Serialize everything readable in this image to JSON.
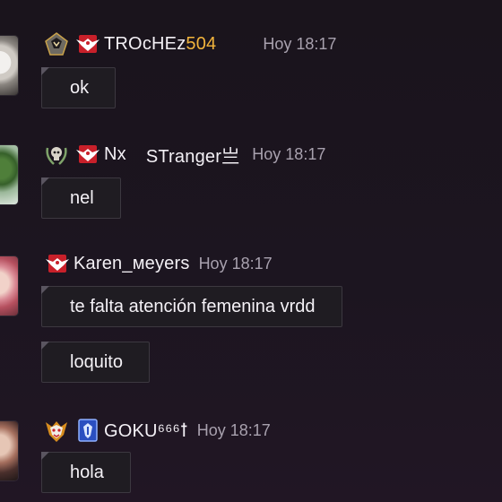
{
  "messages": [
    {
      "username": "TROcHEz",
      "username_suffix": "504",
      "time": "Hoy 18:17",
      "bubbles": [
        "ok"
      ]
    },
    {
      "username": "Nx",
      "username_suffix": "STranger亗",
      "time": "Hoy 18:17",
      "bubbles": [
        "nel"
      ]
    },
    {
      "username": "Karen_ᴍeyers",
      "time": "Hoy 18:17",
      "bubbles": [
        "te falta atención femenina vrdd",
        "loquito"
      ]
    },
    {
      "username": "GOKU⁶⁶⁶ꝉ",
      "time": "Hoy 18:17",
      "bubbles": [
        "hola"
      ]
    }
  ],
  "colors": {
    "background": "#1c1520",
    "bubble_bg": "#1f1c22",
    "bubble_border": "#3c3840",
    "timestamp": "#a8a1ae",
    "gold_name": "#f2b43c",
    "badge_red": "#c8202a"
  },
  "icons": {
    "rank": [
      "rank-emblem-icon",
      "skull-laurel-emblem-icon",
      "demon-mask-emblem-icon"
    ],
    "badge": [
      "red-eagle-badge-icon",
      "blue-shield-badge-icon"
    ]
  }
}
